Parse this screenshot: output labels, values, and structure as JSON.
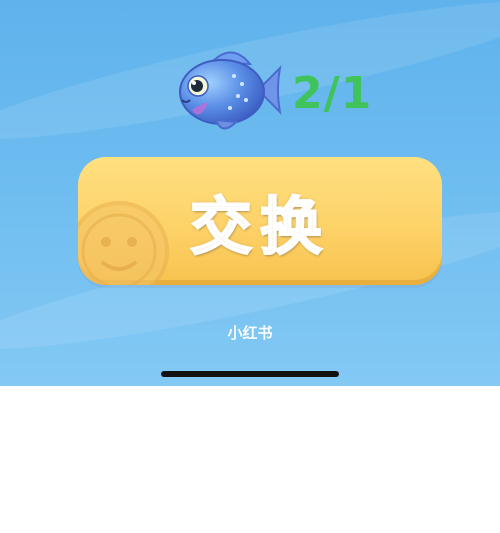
{
  "reward": {
    "item_icon": "fish-icon",
    "count": "2/1",
    "count_color": "#3fc35a"
  },
  "exchange_button": {
    "label": "交换",
    "background": "#fdd268",
    "decor_icon": "coin-icon"
  },
  "watermark": "小红书",
  "colors": {
    "sky": "#6dbcf0",
    "page": "#ffffff"
  }
}
